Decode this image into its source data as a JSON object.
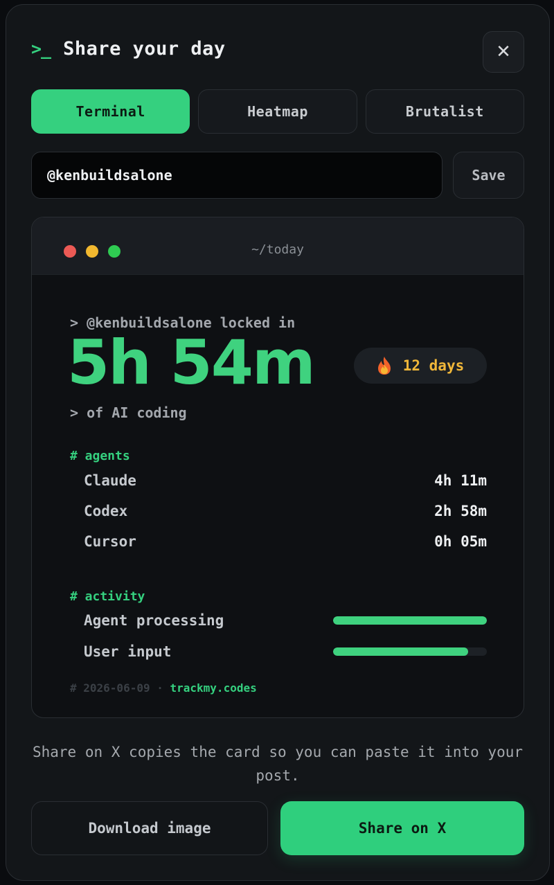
{
  "dialog": {
    "prompt_glyph": ">_",
    "title": "Share your day",
    "close_label": "✕"
  },
  "tabs": [
    {
      "label": "Terminal",
      "active": true
    },
    {
      "label": "Heatmap",
      "active": false
    },
    {
      "label": "Brutalist",
      "active": false
    }
  ],
  "username_field": {
    "value": "@kenbuildsalone",
    "save_label": "Save"
  },
  "card": {
    "window_path": "~/today",
    "locked_in_line": "> @kenbuildsalone locked in",
    "total_time": "5h 54m",
    "coding_line": "> of AI coding",
    "streak": {
      "icon": "fire-icon",
      "label": "12 days"
    },
    "agents_heading": "# agents",
    "agents": [
      {
        "name": "Claude",
        "time": "4h 11m"
      },
      {
        "name": "Codex",
        "time": "2h 58m"
      },
      {
        "name": "Cursor",
        "time": "0h 05m"
      }
    ],
    "activity_heading": "# activity",
    "activity": [
      {
        "label": "Agent processing",
        "level": 1.0
      },
      {
        "label": "User input",
        "level": 0.88
      }
    ],
    "footer_meta": "# 2026-06-09 · ",
    "footer_domain": "trackmy.codes"
  },
  "hint": "Share on X copies the card so you can paste it into your post.",
  "actions": {
    "download_label": "Download image",
    "share_label": "Share on X"
  },
  "colors": {
    "accent": "#35d07f",
    "streak": "#f1b739",
    "dot_red": "#ec5a55",
    "dot_yellow": "#f2b82f",
    "dot_green": "#2fcb52"
  }
}
